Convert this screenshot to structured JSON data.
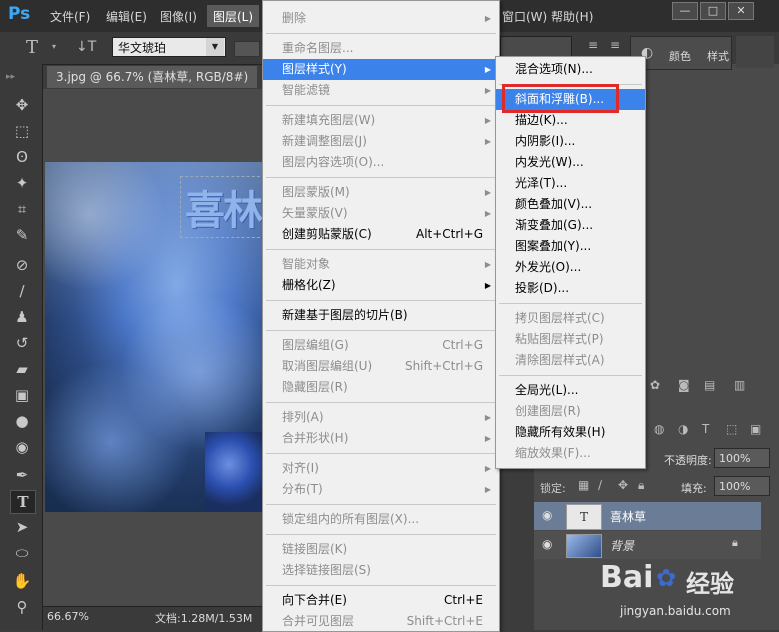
{
  "app": {
    "logo": "Ps"
  },
  "menubar": {
    "items": [
      "文件(F)",
      "编辑(E)",
      "图像(I)",
      "图层(L)"
    ],
    "right_items": [
      "窗口(W)",
      "帮助(H)"
    ],
    "window_buttons": [
      "—",
      "□",
      "✕"
    ]
  },
  "options": {
    "type_icon": "T",
    "orient_icon": "↓T",
    "font_family": "华文琥珀"
  },
  "document": {
    "tab_title": "3.jpg @ 66.7% (喜林草, RGB/8#) *",
    "tab_close": "×",
    "canvas_text": "喜林",
    "zoom": "66.67%",
    "doc_info": "文档:1.28M/1.53M"
  },
  "layer_menu": {
    "items": [
      {
        "label": "删除",
        "shortcut": "",
        "arrow": true,
        "disabled": true
      },
      {
        "sep": true
      },
      {
        "label": "重命名图层...",
        "shortcut": "",
        "arrow": false,
        "disabled": true
      },
      {
        "label": "图层样式(Y)",
        "shortcut": "",
        "arrow": true,
        "disabled": false,
        "highlight": true
      },
      {
        "label": "智能滤镜",
        "shortcut": "",
        "arrow": true,
        "disabled": true
      },
      {
        "sep": true
      },
      {
        "label": "新建填充图层(W)",
        "shortcut": "",
        "arrow": true,
        "disabled": true
      },
      {
        "label": "新建调整图层(J)",
        "shortcut": "",
        "arrow": true,
        "disabled": true
      },
      {
        "label": "图层内容选项(O)...",
        "shortcut": "",
        "arrow": false,
        "disabled": true
      },
      {
        "sep": true
      },
      {
        "label": "图层蒙版(M)",
        "shortcut": "",
        "arrow": true,
        "disabled": true
      },
      {
        "label": "矢量蒙版(V)",
        "shortcut": "",
        "arrow": true,
        "disabled": true
      },
      {
        "label": "创建剪贴蒙版(C)",
        "shortcut": "Alt+Ctrl+G",
        "arrow": false,
        "disabled": false
      },
      {
        "sep": true
      },
      {
        "label": "智能对象",
        "shortcut": "",
        "arrow": true,
        "disabled": true
      },
      {
        "label": "栅格化(Z)",
        "shortcut": "",
        "arrow": true,
        "disabled": false
      },
      {
        "sep": true
      },
      {
        "label": "新建基于图层的切片(B)",
        "shortcut": "",
        "arrow": false,
        "disabled": false
      },
      {
        "sep": true
      },
      {
        "label": "图层编组(G)",
        "shortcut": "Ctrl+G",
        "arrow": false,
        "disabled": true
      },
      {
        "label": "取消图层编组(U)",
        "shortcut": "Shift+Ctrl+G",
        "arrow": false,
        "disabled": true
      },
      {
        "label": "隐藏图层(R)",
        "shortcut": "",
        "arrow": false,
        "disabled": true
      },
      {
        "sep": true
      },
      {
        "label": "排列(A)",
        "shortcut": "",
        "arrow": true,
        "disabled": true
      },
      {
        "label": "合并形状(H)",
        "shortcut": "",
        "arrow": true,
        "disabled": true
      },
      {
        "sep": true
      },
      {
        "label": "对齐(I)",
        "shortcut": "",
        "arrow": true,
        "disabled": true
      },
      {
        "label": "分布(T)",
        "shortcut": "",
        "arrow": true,
        "disabled": true
      },
      {
        "sep": true
      },
      {
        "label": "锁定组内的所有图层(X)...",
        "shortcut": "",
        "arrow": false,
        "disabled": true
      },
      {
        "sep": true
      },
      {
        "label": "链接图层(K)",
        "shortcut": "",
        "arrow": false,
        "disabled": true
      },
      {
        "label": "选择链接图层(S)",
        "shortcut": "",
        "arrow": false,
        "disabled": true
      },
      {
        "sep": true
      },
      {
        "label": "向下合并(E)",
        "shortcut": "Ctrl+E",
        "arrow": false,
        "disabled": false
      },
      {
        "label": "合并可见图层",
        "shortcut": "Shift+Ctrl+E",
        "arrow": false,
        "disabled": true
      }
    ]
  },
  "style_menu": {
    "items": [
      {
        "label": "混合选项(N)...",
        "disabled": false
      },
      {
        "sep": true
      },
      {
        "label": "斜面和浮雕(B)...",
        "disabled": false,
        "highlight": true
      },
      {
        "label": "描边(K)...",
        "disabled": false
      },
      {
        "label": "内阴影(I)...",
        "disabled": false
      },
      {
        "label": "内发光(W)...",
        "disabled": false
      },
      {
        "label": "光泽(T)...",
        "disabled": false
      },
      {
        "label": "颜色叠加(V)...",
        "disabled": false
      },
      {
        "label": "渐变叠加(G)...",
        "disabled": false
      },
      {
        "label": "图案叠加(Y)...",
        "disabled": false
      },
      {
        "label": "外发光(O)...",
        "disabled": false
      },
      {
        "label": "投影(D)...",
        "disabled": false
      },
      {
        "sep": true
      },
      {
        "label": "拷贝图层样式(C)",
        "disabled": true
      },
      {
        "label": "粘贴图层样式(P)",
        "disabled": true
      },
      {
        "label": "清除图层样式(A)",
        "disabled": true
      },
      {
        "sep": true
      },
      {
        "label": "全局光(L)...",
        "disabled": false
      },
      {
        "label": "创建图层(R)",
        "disabled": true
      },
      {
        "label": "隐藏所有效果(H)",
        "disabled": false
      },
      {
        "label": "缩放效果(F)...",
        "disabled": true
      }
    ]
  },
  "panels": {
    "color_label": "颜色",
    "style_label": "样式",
    "opacity_label": "不透明度:",
    "opacity_value": "100%",
    "fill_label": "填充:",
    "fill_value": "100%",
    "lock_label": "锁定:",
    "layers": [
      {
        "name": "喜林草",
        "type": "text",
        "thumb": "T"
      },
      {
        "name": "背景",
        "type": "image",
        "thumb": ""
      }
    ]
  },
  "watermark": {
    "brand": "Bai",
    "brand2": "经验",
    "url": "jingyan.baidu.com"
  },
  "colors": {
    "accent": "#3b83ea",
    "highlight_box": "#e02a2a",
    "ps_blue": "#3da8f5"
  }
}
